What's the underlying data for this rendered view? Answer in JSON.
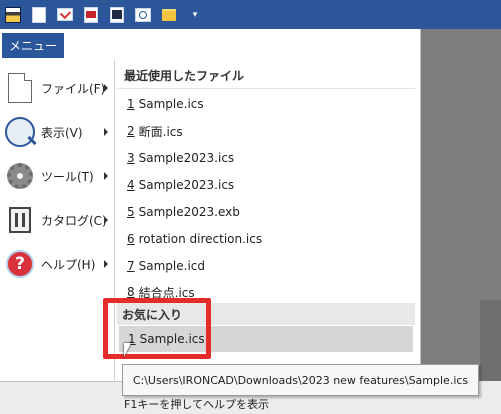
{
  "toolbar": {
    "icons": [
      "app-icon",
      "new-document-icon",
      "mail-icon",
      "red-document-icon",
      "catalog-document-icon",
      "camera-icon",
      "open-folder-icon",
      "dropdown-arrow-icon"
    ]
  },
  "menu": {
    "tab_label": "メニュー",
    "nav": [
      {
        "label": "ファイル(F)",
        "icon": "file-icon"
      },
      {
        "label": "表示(V)",
        "icon": "magnifier-icon"
      },
      {
        "label": "ツール(T)",
        "icon": "gear-icon"
      },
      {
        "label": "カタログ(C)",
        "icon": "catalog-icon"
      },
      {
        "label": "ヘルプ(H)",
        "icon": "help-icon"
      }
    ]
  },
  "recent": {
    "header": "最近使用したファイル",
    "items": [
      {
        "num": "1",
        "name": "Sample.ics"
      },
      {
        "num": "2",
        "name": "断面.ics"
      },
      {
        "num": "3",
        "name": "Sample2023.ics"
      },
      {
        "num": "4",
        "name": "Sample2023.ics"
      },
      {
        "num": "5",
        "name": "Sample2023.exb"
      },
      {
        "num": "6",
        "name": "rotation direction.ics"
      },
      {
        "num": "7",
        "name": "Sample.icd"
      },
      {
        "num": "8",
        "name": "結合点.ics"
      }
    ]
  },
  "favorites": {
    "header": "お気に入り",
    "items": [
      {
        "num": "1",
        "name": "Sample.ics"
      }
    ]
  },
  "tooltip": "C:\\Users\\IRONCAD\\Downloads\\2023 new features\\Sample.ics",
  "status": "F1キーを押してヘルプを表示",
  "colors": {
    "accent": "#2b579a",
    "highlight": "#e62b2b"
  }
}
